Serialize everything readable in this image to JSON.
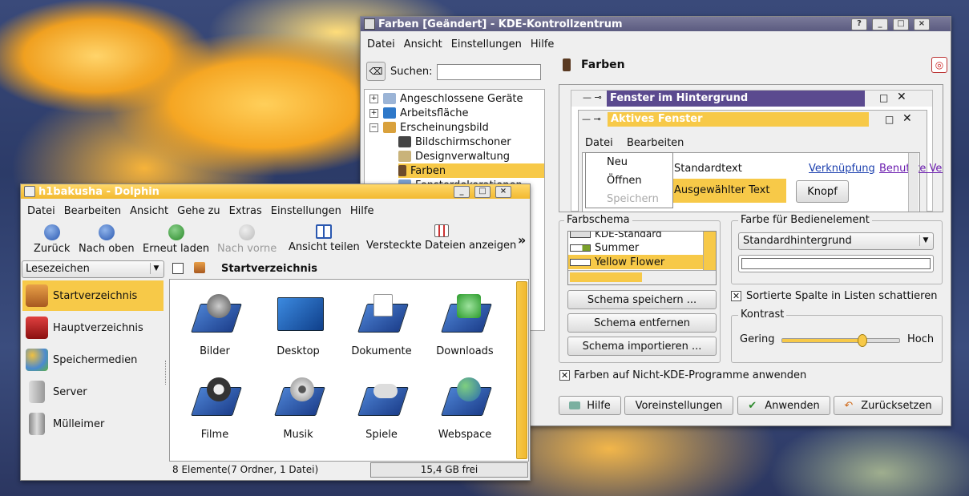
{
  "kcontrol": {
    "title": "Farben [Geändert] - KDE-Kontrollzentrum",
    "menu": [
      "Datei",
      "Ansicht",
      "Einstellungen",
      "Hilfe"
    ],
    "search_label": "Suchen:",
    "search_value": "",
    "tree": [
      {
        "label": "Angeschlossene Geräte",
        "expander": "+",
        "level": 0
      },
      {
        "label": "Arbeitsfläche",
        "expander": "+",
        "level": 0
      },
      {
        "label": "Erscheinungsbild",
        "expander": "−",
        "level": 0
      },
      {
        "label": "Bildschirmschoner",
        "level": 1
      },
      {
        "label": "Designverwaltung",
        "level": 1
      },
      {
        "label": "Farben",
        "level": 1,
        "selected": true
      },
      {
        "label": "Fensterdekorationen",
        "level": 1
      }
    ],
    "module_title": "Farben",
    "preview": {
      "inactive_title": "Fenster im Hintergrund",
      "active_title": "Aktives Fenster",
      "menu": [
        "Datei",
        "Bearbeiten"
      ],
      "popup": [
        "Neu",
        "Öffnen",
        "Speichern"
      ],
      "standard_text": "Standardtext",
      "selected_text": "Ausgewählter Text",
      "link": "Verknüpfung",
      "visited_link": "Benutzte Ver",
      "button": "Knopf"
    },
    "scheme": {
      "legend": "Farbschema",
      "items": [
        "KDE-Standard",
        "Summer",
        "Yellow Flower"
      ],
      "selected": "Yellow Flower",
      "save": "Schema speichern ...",
      "remove": "Schema entfernen",
      "import": "Schema importieren ..."
    },
    "widget_color": {
      "legend": "Farbe für Bedienelement",
      "selected": "Standardhintergrund"
    },
    "shade_sorted": "Sortierte Spalte in Listen schattieren",
    "contrast": {
      "legend": "Kontrast",
      "low": "Gering",
      "high": "Hoch",
      "value": 0.68
    },
    "apply_nonkde": "Farben auf Nicht-KDE-Programme anwenden",
    "buttons": {
      "help": "Hilfe",
      "defaults": "Voreinstellungen",
      "apply": "Anwenden",
      "reset": "Zurücksetzen"
    }
  },
  "dolphin": {
    "title": "h1bakusha - Dolphin",
    "menu": [
      "Datei",
      "Bearbeiten",
      "Ansicht",
      "Gehe zu",
      "Extras",
      "Einstellungen",
      "Hilfe"
    ],
    "toolbar": [
      "Zurück",
      "Nach oben",
      "Erneut laden",
      "Nach vorne",
      "Ansicht teilen",
      "Versteckte Dateien anzeigen"
    ],
    "more": "»",
    "panel_select": "Lesezeichen",
    "places": [
      "Startverzeichnis",
      "Hauptverzeichnis",
      "Speichermedien",
      "Server",
      "Mülleimer"
    ],
    "location": "Startverzeichnis",
    "files": [
      "Bilder",
      "Desktop",
      "Dokumente",
      "Downloads",
      "Filme",
      "Musik",
      "Spiele",
      "Webspace"
    ],
    "status": "8 Elemente(7 Ordner, 1 Datei)",
    "free": "15,4 GB frei"
  },
  "colors": {
    "accent": "#f7c948",
    "inactive_title": "#5b4a8f",
    "link": "#1b3fae"
  }
}
